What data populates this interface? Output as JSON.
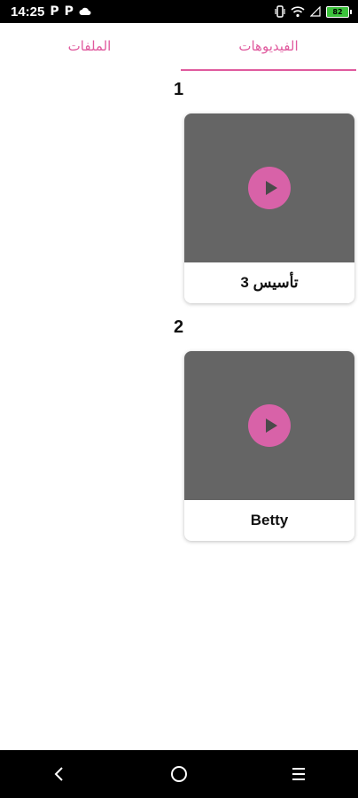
{
  "status_bar": {
    "time": "14:25",
    "left_icons": [
      "P",
      "P"
    ],
    "battery_level": "82"
  },
  "tabs": [
    {
      "label": "الفيديوهات",
      "active": true
    },
    {
      "label": "الملفات",
      "active": false
    }
  ],
  "videos": [
    {
      "number": "1",
      "title": "تأسيس 3"
    },
    {
      "number": "2",
      "title": "Betty"
    }
  ],
  "colors": {
    "accent": "#e05a9e",
    "play_button": "#d862a8",
    "thumbnail_bg": "#656565"
  },
  "nav_bar": {
    "icons": [
      "back-icon",
      "home-icon",
      "recents-icon"
    ]
  }
}
